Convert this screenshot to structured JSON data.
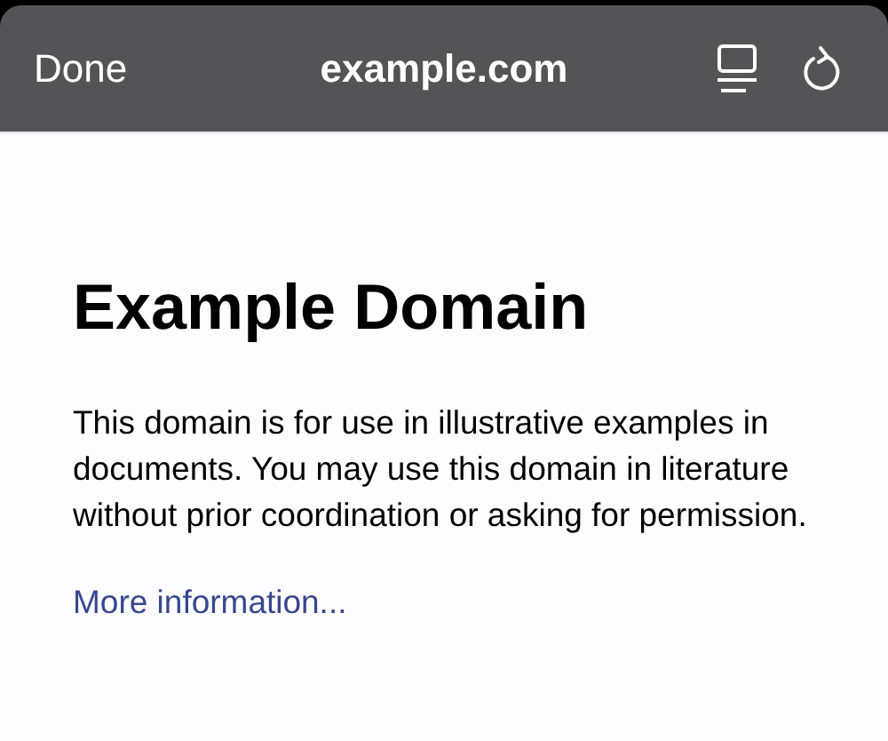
{
  "toolbar": {
    "done": "Done",
    "title": "example.com"
  },
  "page": {
    "heading": "Example Domain",
    "paragraph": "This domain is for use in illustrative examples in documents. You may use this domain in literature without prior coordination or asking for permission.",
    "link": "More information..."
  }
}
